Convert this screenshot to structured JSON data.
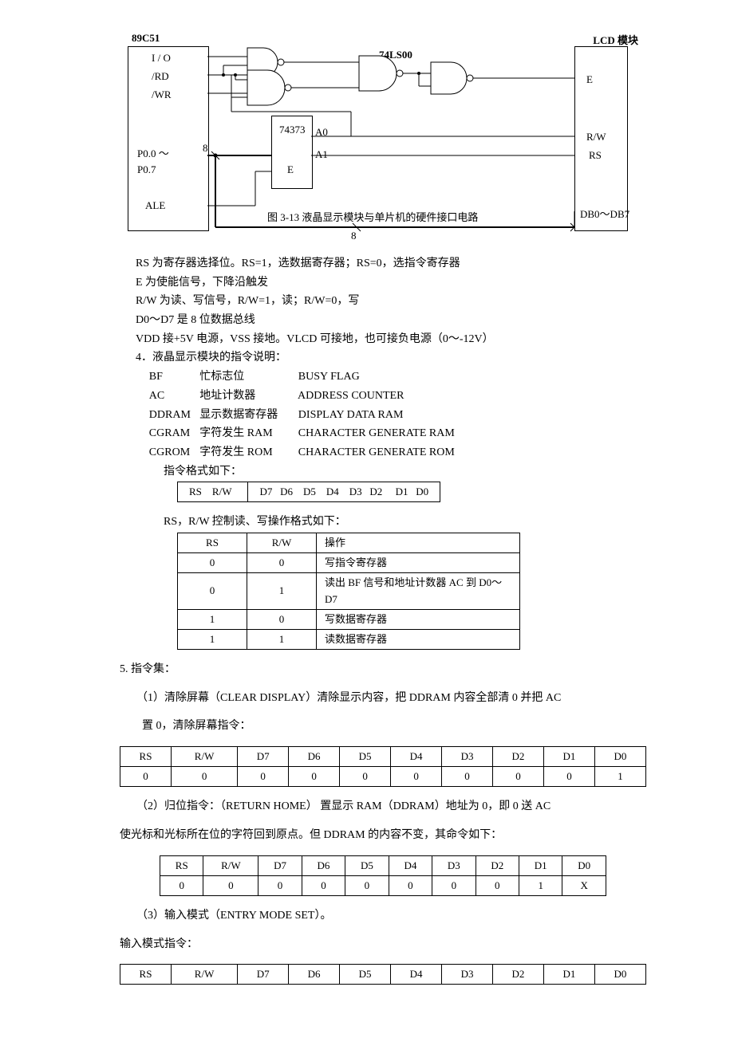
{
  "diagram": {
    "cpu_label": "89C51",
    "lcd_label": "LCD 模块",
    "chip74ls00": "74LS00",
    "chip74373": "74373",
    "chipE": "E",
    "cpu_pins": {
      "io": "I / O",
      "rd": "/RD",
      "wr": "/WR",
      "p00": "P0.0   ～",
      "p07": "P0.7",
      "ale": "ALE"
    },
    "lcd_pins": {
      "e": "E",
      "rw": "R/W",
      "rs": "RS",
      "db": "DB0～DB7"
    },
    "a0": "A0",
    "a1": "A1",
    "bus8a": "8",
    "bus8b": "8",
    "caption": "图 3-13 液晶显示模块与单片机的硬件接口电路"
  },
  "paras": {
    "p1": "RS 为寄存器选择位。RS=1，选数据寄存器；RS=0，选指令寄存器",
    "p2": "E 为使能信号，下降沿触发",
    "p3": "R/W 为读、写信号，R/W=1，读；R/W=0，写",
    "p4": "D0～D7 是 8 位数据总线",
    "p5": "VDD 接+5V 电源，VSS 接地。VLCD 可接地，也可接负电源（0～-12V）",
    "p6": "4．液晶显示模块的指令说明：",
    "defs": {
      "bf": {
        "k": "BF",
        "c": "忙标志位",
        "e": "BUSY   FLAG"
      },
      "ac": {
        "k": "AC",
        "c": "地址计数器",
        "e": "ADDRESS   COUNTER"
      },
      "ddram": {
        "k": "DDRAM",
        "c": "显示数据寄存器",
        "e": "DISPLAY   DATA   RAM"
      },
      "cgram": {
        "k": "CGRAM",
        "c": "字符发生 RAM",
        "e": "CHARACTER   GENERATE   RAM"
      },
      "cgrom": {
        "k": "CGROM",
        "c": "字符发生 ROM",
        "e": "CHARACTER   GENERATE   ROM"
      }
    },
    "fmt_title": "指令格式如下：",
    "fmt_cells": {
      "rs": "RS",
      "rw": "R/W",
      "d7": "D7",
      "d6": "D6",
      "d5": "D5",
      "d4": "D4",
      "d3": "D3",
      "d2": "D2",
      "d1": "D1",
      "d0": "D0"
    },
    "rw_title": "RS，R/W 控制读、写操作格式如下：",
    "rw_header": {
      "rs": "RS",
      "rw": "R/W",
      "op": "操作"
    },
    "rw_rows": [
      {
        "rs": "0",
        "rw": "0",
        "op": "写指令寄存器"
      },
      {
        "rs": "0",
        "rw": "1",
        "op": "读出 BF 信号和地址计数器 AC 到 D0～D7"
      },
      {
        "rs": "1",
        "rw": "0",
        "op": "写数据寄存器"
      },
      {
        "rs": "1",
        "rw": "1",
        "op": "读数据寄存器"
      }
    ],
    "sec5": "5. 指令集：",
    "cmd1_t1": "（1）清除屏幕（CLEAR   DISPLAY）清除显示内容，把 DDRAM 内容全部清 0 并把 AC",
    "cmd1_t2": "置 0，清除屏幕指令：",
    "cmd1_head": [
      "RS",
      "R/W",
      "D7",
      "D6",
      "D5",
      "D4",
      "D3",
      "D2",
      "D1",
      "D0"
    ],
    "cmd1_vals": [
      "0",
      "0",
      "0",
      "0",
      "0",
      "0",
      "0",
      "0",
      "0",
      "1"
    ],
    "cmd2_t1": "（2）归位指令：（RETURN   HOME） 置显示 RAM（DDRAM）地址为 0，即 0 送 AC",
    "cmd2_t2": "使光标和光标所在位的字符回到原点。但 DDRAM 的内容不变，其命令如下：",
    "cmd2_head": [
      "RS",
      "R/W",
      "D7",
      "D6",
      "D5",
      "D4",
      "D3",
      "D2",
      "D1",
      "D0"
    ],
    "cmd2_vals": [
      "0",
      "0",
      "0",
      "0",
      "0",
      "0",
      "0",
      "0",
      "1",
      "X"
    ],
    "cmd3_t": "（3）输入模式（ENTRY   MODE   SET）。",
    "cmd3_t2": "输入模式指令：",
    "cmd3_head": [
      "RS",
      "R/W",
      "D7",
      "D6",
      "D5",
      "D4",
      "D3",
      "D2",
      "D1",
      "D0"
    ]
  }
}
